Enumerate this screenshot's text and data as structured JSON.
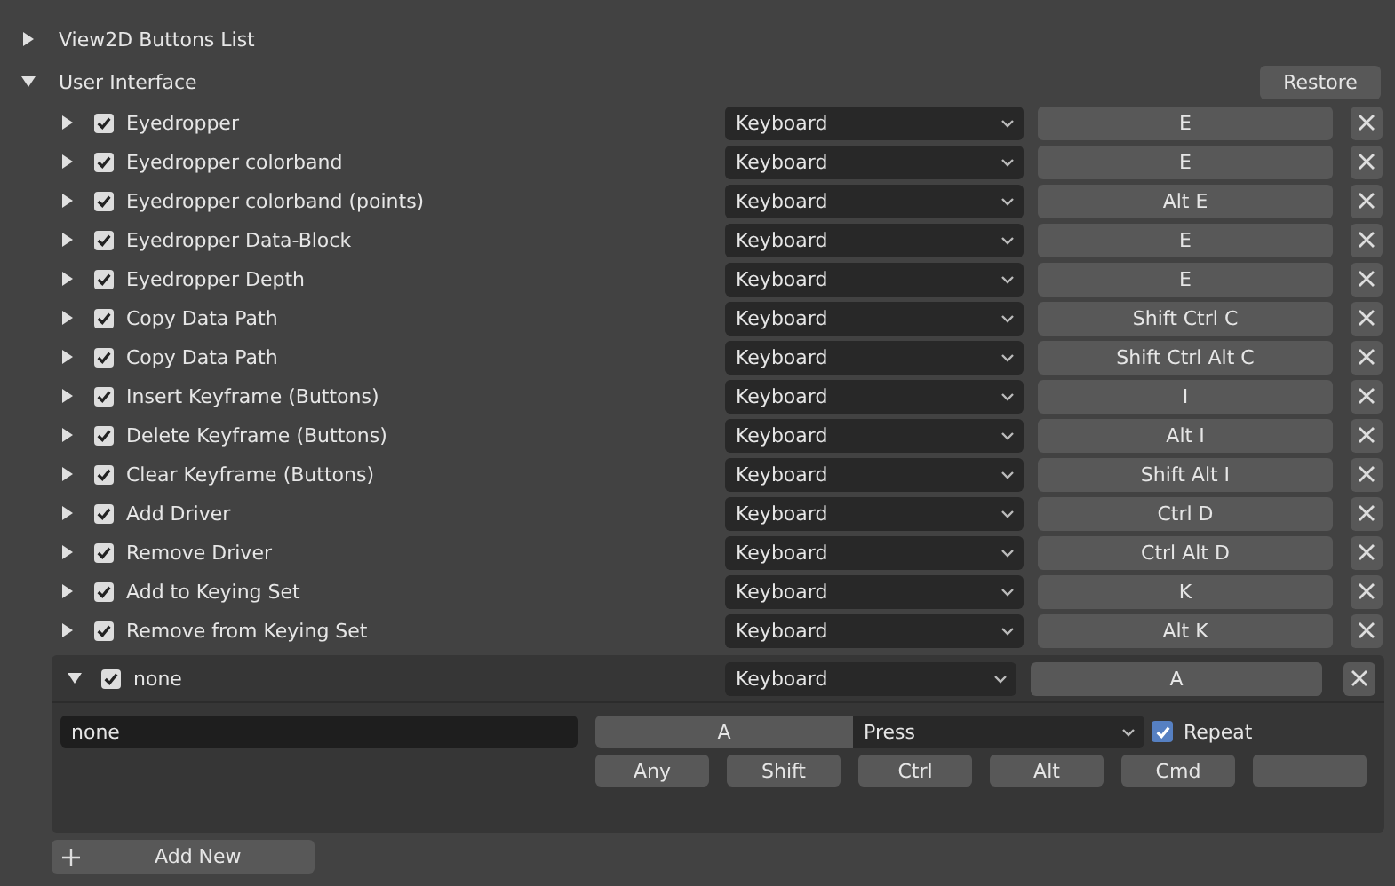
{
  "sections": [
    {
      "label": "View2D Buttons List",
      "expanded": false
    },
    {
      "label": "User Interface",
      "expanded": true
    }
  ],
  "restore_button": "Restore",
  "items": [
    {
      "name": "Eyedropper",
      "checked": true,
      "expanded": false,
      "map_type": "Keyboard",
      "key": "E"
    },
    {
      "name": "Eyedropper colorband",
      "checked": true,
      "expanded": false,
      "map_type": "Keyboard",
      "key": "E"
    },
    {
      "name": "Eyedropper colorband (points)",
      "checked": true,
      "expanded": false,
      "map_type": "Keyboard",
      "key": "Alt E"
    },
    {
      "name": "Eyedropper Data-Block",
      "checked": true,
      "expanded": false,
      "map_type": "Keyboard",
      "key": "E"
    },
    {
      "name": "Eyedropper Depth",
      "checked": true,
      "expanded": false,
      "map_type": "Keyboard",
      "key": "E"
    },
    {
      "name": "Copy Data Path",
      "checked": true,
      "expanded": false,
      "map_type": "Keyboard",
      "key": "Shift Ctrl C"
    },
    {
      "name": "Copy Data Path",
      "checked": true,
      "expanded": false,
      "map_type": "Keyboard",
      "key": "Shift Ctrl Alt C"
    },
    {
      "name": "Insert Keyframe (Buttons)",
      "checked": true,
      "expanded": false,
      "map_type": "Keyboard",
      "key": "I"
    },
    {
      "name": "Delete Keyframe (Buttons)",
      "checked": true,
      "expanded": false,
      "map_type": "Keyboard",
      "key": "Alt I"
    },
    {
      "name": "Clear Keyframe (Buttons)",
      "checked": true,
      "expanded": false,
      "map_type": "Keyboard",
      "key": "Shift Alt I"
    },
    {
      "name": "Add Driver",
      "checked": true,
      "expanded": false,
      "map_type": "Keyboard",
      "key": "Ctrl D"
    },
    {
      "name": "Remove Driver",
      "checked": true,
      "expanded": false,
      "map_type": "Keyboard",
      "key": "Ctrl Alt D"
    },
    {
      "name": "Add to Keying Set",
      "checked": true,
      "expanded": false,
      "map_type": "Keyboard",
      "key": "K"
    },
    {
      "name": "Remove from Keying Set",
      "checked": true,
      "expanded": false,
      "map_type": "Keyboard",
      "key": "Alt K"
    },
    {
      "name": "none",
      "checked": true,
      "expanded": true,
      "map_type": "Keyboard",
      "key": "A",
      "detail": {
        "identifier": "none",
        "key": "A",
        "event": "Press",
        "repeat_label": "Repeat",
        "repeat": true,
        "modifiers": [
          {
            "kind": "toggle",
            "label": "Any",
            "on": false
          },
          {
            "kind": "toggle",
            "label": "Shift",
            "on": false
          },
          {
            "kind": "toggle",
            "label": "Ctrl",
            "on": false
          },
          {
            "kind": "toggle",
            "label": "Alt",
            "on": false
          },
          {
            "kind": "toggle",
            "label": "Cmd",
            "on": false
          },
          {
            "kind": "key-field"
          }
        ]
      }
    }
  ],
  "add_new_button": "Add New"
}
